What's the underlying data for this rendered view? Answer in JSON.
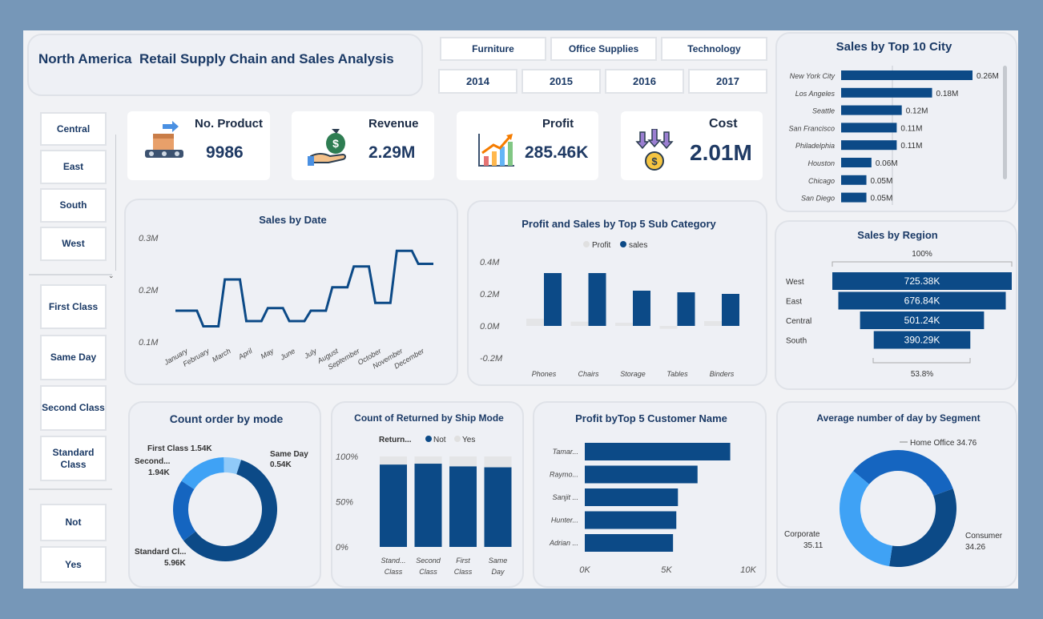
{
  "header": {
    "title": "North America  Retail Supply Chain and Sales Analysis"
  },
  "category_slicer": [
    "Furniture",
    "Office Supplies",
    "Technology"
  ],
  "year_slicer": [
    "2014",
    "2015",
    "2016",
    "2017"
  ],
  "region_slicer": [
    "Central",
    "East",
    "South",
    "West"
  ],
  "shipmode_slicer": [
    "First Class",
    "Same Day",
    "Second Class",
    "Standard Class"
  ],
  "returned_slicer": [
    "Not",
    "Yes"
  ],
  "kpis": {
    "product": {
      "label": "No. Product",
      "value": "9986"
    },
    "revenue": {
      "label": "Revenue",
      "value": "2.29M"
    },
    "profit": {
      "label": "Profit",
      "value": "285.46K"
    },
    "cost": {
      "label": "Cost",
      "value": "2.01M"
    }
  },
  "colors": {
    "primary": "#0c4a87",
    "light": "#3fa2f5",
    "mid": "#1565c0",
    "grey": "#e5e6e8"
  },
  "chart_data": [
    {
      "id": "city",
      "type": "bar",
      "title": "Sales by Top 10 City",
      "categories": [
        "New York City",
        "Los Angeles",
        "Seattle",
        "San Francisco",
        "Philadelphia",
        "Houston",
        "Chicago",
        "San Diego"
      ],
      "values": [
        0.26,
        0.18,
        0.12,
        0.11,
        0.11,
        0.06,
        0.05,
        0.05
      ],
      "labels": [
        "0.26M",
        "0.18M",
        "0.12M",
        "0.11M",
        "0.11M",
        "0.06M",
        "0.05M",
        "0.05M"
      ]
    },
    {
      "id": "date",
      "type": "line",
      "title": "Sales by Date",
      "categories": [
        "January",
        "February",
        "March",
        "April",
        "May",
        "June",
        "July",
        "August",
        "September",
        "October",
        "November",
        "December"
      ],
      "values": [
        0.16,
        0.13,
        0.22,
        0.14,
        0.165,
        0.14,
        0.16,
        0.205,
        0.245,
        0.175,
        0.275,
        0.25
      ],
      "yticks": [
        "0.3M",
        "0.2M",
        "0.1M"
      ],
      "ylim": [
        0.1,
        0.3
      ]
    },
    {
      "id": "subcat",
      "type": "bar",
      "title": "Profit and Sales by Top 5 Sub Category",
      "legend": [
        "Profit",
        "sales"
      ],
      "categories": [
        "Phones",
        "Chairs",
        "Storage",
        "Tables",
        "Binders"
      ],
      "series": [
        {
          "name": "Profit",
          "values": [
            0.045,
            0.027,
            0.02,
            -0.018,
            0.03
          ]
        },
        {
          "name": "sales",
          "values": [
            0.33,
            0.33,
            0.22,
            0.21,
            0.2
          ]
        }
      ],
      "yticks": [
        "0.4M",
        "0.2M",
        "0.0M",
        "-0.2M"
      ],
      "ylim": [
        -0.2,
        0.4
      ]
    },
    {
      "id": "region",
      "type": "bar",
      "title": "Sales by Region",
      "categories": [
        "West",
        "East",
        "Central",
        "South"
      ],
      "values": [
        725.38,
        676.84,
        501.24,
        390.29
      ],
      "labels": [
        "725.38K",
        "676.84K",
        "501.24K",
        "390.29K"
      ],
      "top_label": "100%",
      "bottom_label": "53.8%"
    },
    {
      "id": "mode",
      "type": "pie",
      "title": "Count order by mode",
      "categories": [
        "Standard Class",
        "Second Class",
        "First Class",
        "Same Day"
      ],
      "values": [
        5.96,
        1.94,
        1.54,
        0.54
      ],
      "labels": [
        {
          "name": "Standard Cl...",
          "value": "5.96K"
        },
        {
          "name": "Second...",
          "value": "1.94K"
        },
        {
          "name": "First Class",
          "value": "1.54K"
        },
        {
          "name": "Same Day",
          "value": "0.54K"
        }
      ]
    },
    {
      "id": "returned",
      "type": "bar",
      "title": "Count of Returned by Ship Mode",
      "legend_title": "Return...",
      "legend": [
        "Not",
        "Yes"
      ],
      "categories": [
        "Stand... Class",
        "Second Class",
        "First Class",
        "Same Day"
      ],
      "series": [
        {
          "name": "Not",
          "values": [
            91,
            92,
            89,
            88
          ]
        },
        {
          "name": "Yes",
          "values": [
            9,
            8,
            11,
            12
          ]
        }
      ],
      "yticks": [
        "100%",
        "50%",
        "0%"
      ]
    },
    {
      "id": "customer",
      "type": "bar",
      "title": "Profit byTop 5 Customer Name",
      "categories": [
        "Tamar...",
        "Raymo...",
        "Sanjit ...",
        "Hunter...",
        "Adrian ..."
      ],
      "values": [
        8900,
        6900,
        5700,
        5600,
        5400
      ],
      "xticks": [
        "0K",
        "5K",
        "10K"
      ],
      "xlim": [
        0,
        10000
      ]
    },
    {
      "id": "segment",
      "type": "pie",
      "title": "Average number of day by Segment",
      "categories": [
        "Home Office",
        "Consumer",
        "Corporate"
      ],
      "values": [
        34.76,
        34.26,
        35.11
      ],
      "labels": [
        "Home Office 34.76",
        "Consumer 34.26",
        "Corporate 35.11"
      ]
    }
  ]
}
